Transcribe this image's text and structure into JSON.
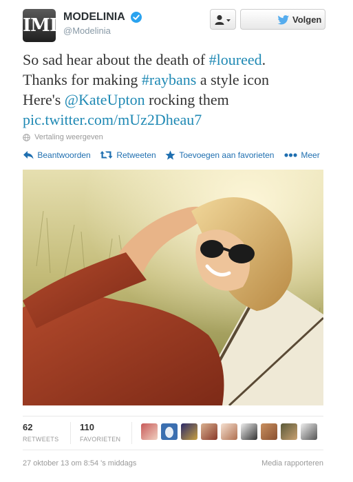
{
  "profile": {
    "fullname": "MODELINIA",
    "screenname": "@Modelinia",
    "avatar_text": "IMI",
    "verified": true
  },
  "buttons": {
    "user_dropdown_icon": "user-icon",
    "follow_label": "Volgen",
    "follow_icon": "twitter-bird-icon"
  },
  "tweet": {
    "line1_text": "So sad hear about the death of ",
    "line1_hashtag": "#loureed",
    "line1_end": ".",
    "line2_text": "Thanks for making ",
    "line2_hashtag": "#raybans",
    "line2_end": " a style icon",
    "line3_text": "Here's ",
    "line3_mention": "@KateUpton",
    "line3_end": " rocking them",
    "line4_link": "pic.twitter.com/mUz2Dheau7"
  },
  "translate_label": "Vertaling weergeven",
  "actions": {
    "reply": "Beantwoorden",
    "retweet": "Retweeten",
    "favorite": "Toevoegen aan favorieten",
    "more": "Meer"
  },
  "stats": {
    "retweets_count": "62",
    "retweets_label": "RETWEETS",
    "favorites_count": "110",
    "favorites_label": "FAVORIETEN"
  },
  "footer": {
    "timestamp": "27 oktober 13 om 8:54 's middags",
    "report": "Media rapporteren"
  },
  "colors": {
    "link": "#1f89b4",
    "action": "#1f6fb0",
    "verified": "#2aa3ef",
    "muted": "#999999"
  }
}
